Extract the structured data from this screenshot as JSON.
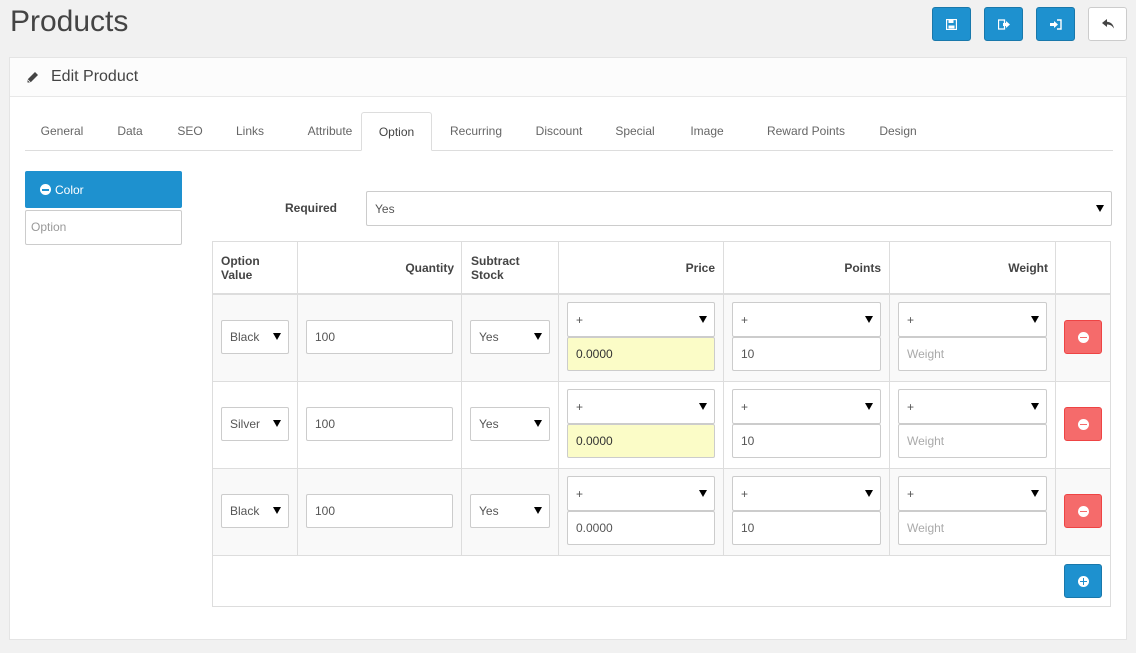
{
  "page": {
    "title": "Products"
  },
  "header_buttons": [
    {
      "icon": "save-icon"
    },
    {
      "icon": "save-stay-icon"
    },
    {
      "icon": "sign-in-icon"
    },
    {
      "icon": "reply-icon"
    }
  ],
  "panel": {
    "title": "Edit Product",
    "icon": "pencil-icon"
  },
  "tabs": [
    "General",
    "Data",
    "SEO",
    "Links",
    "Attribute",
    "Option",
    "Recurring",
    "Discount",
    "Special",
    "Image",
    "Reward Points",
    "Design"
  ],
  "active_tab": "Option",
  "option_sidebar": {
    "item_label": "Color",
    "input_placeholder": "Option"
  },
  "required": {
    "label": "Required",
    "value": "Yes"
  },
  "table": {
    "headers": [
      "Option Value",
      "Quantity",
      "Subtract Stock",
      "Price",
      "Points",
      "Weight"
    ],
    "rows": [
      {
        "option_value": "Black",
        "quantity": "100",
        "subtract": "Yes",
        "price_prefix": "+",
        "price": "0.0000",
        "points_prefix": "+",
        "points": "10",
        "weight_prefix": "+",
        "weight_placeholder": "Weight"
      },
      {
        "option_value": "Silver",
        "quantity": "100",
        "subtract": "Yes",
        "price_prefix": "+",
        "price": "0.0000",
        "points_prefix": "+",
        "points": "10",
        "weight_prefix": "+",
        "weight_placeholder": "Weight"
      },
      {
        "option_value": "Black",
        "quantity": "100",
        "subtract": "Yes",
        "price_prefix": "+",
        "price": "0.0000",
        "points_prefix": "+",
        "points": "10",
        "weight_prefix": "+",
        "weight_placeholder": "Weight"
      }
    ]
  },
  "colors": {
    "primary": "#1e91cf",
    "danger": "#f56b6b",
    "highlight": "#fbfcc7"
  }
}
